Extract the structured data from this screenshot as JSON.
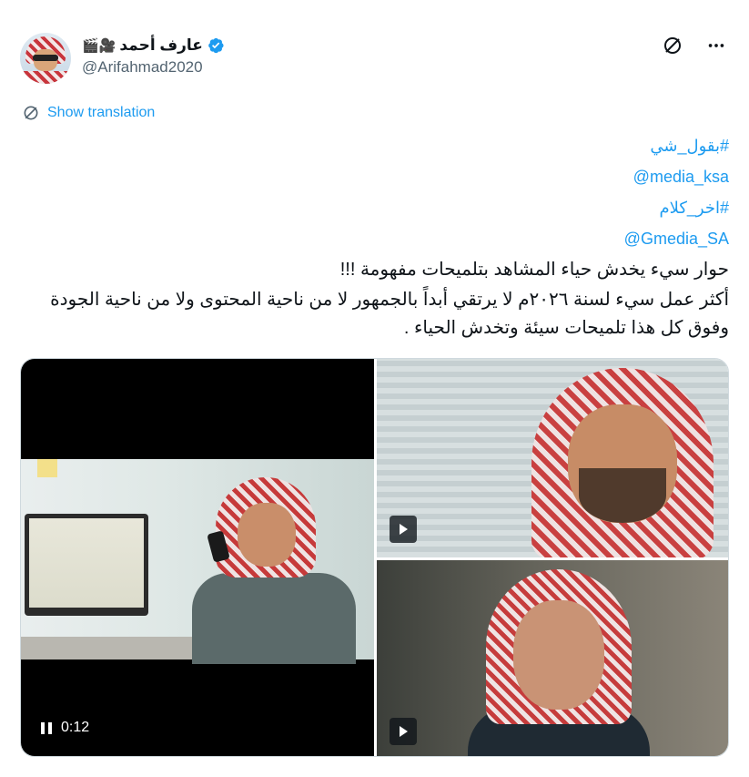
{
  "author": {
    "display_name": "عارف أحمد",
    "emoji": "🎬🎥",
    "handle": "@Arifahmad2020"
  },
  "actions": {
    "translate_label": "Show translation"
  },
  "tweet": {
    "hashtag1": "#بقول_شي",
    "mention1": "@media_ksa",
    "hashtag2": "#اخر_كلام",
    "mention2": "@Gmedia_SA",
    "line1": "حوار سيء يخدش حياء المشاهد بتلميحات مفهومة !!!",
    "line2": "أكثر عمل سيء لسنة ٢٠٢٦م لا يرتقي أبداً بالجمهور لا من ناحية المحتوى ولا من ناحية الجودة وفوق كل هذا تلميحات سيئة وتخدش الحياء ."
  },
  "media": {
    "main_video_time": "0:12",
    "icons": [
      "pause-icon",
      "play-icon",
      "play-icon"
    ]
  },
  "colors": {
    "accent": "#1d9bf0",
    "secondary_text": "#536471"
  }
}
